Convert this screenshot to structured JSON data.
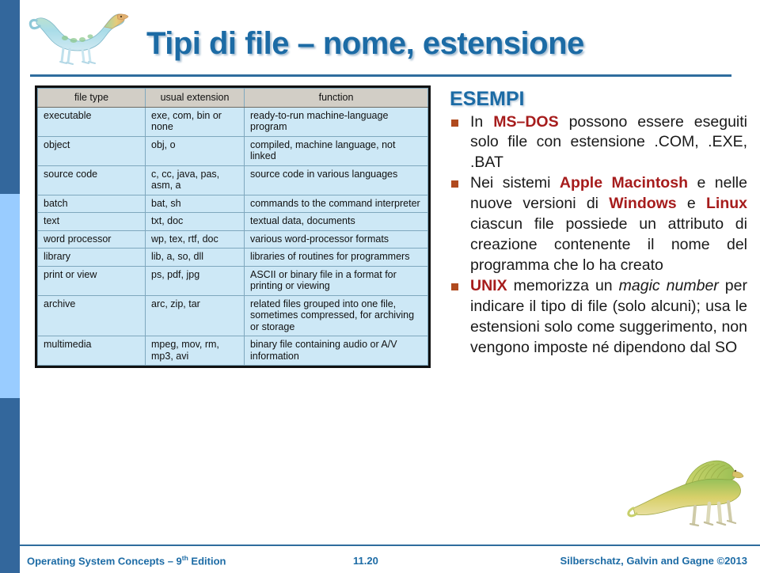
{
  "colors": {
    "title_blue": "#1C6BA5",
    "sidebar_dark": "#33679C",
    "sidebar_light": "#99CCFF",
    "table_header_bg": "#D2CEC6",
    "table_row_bg": "#CDE8F6",
    "highlight_red": "#A61C1C",
    "bullet_orange": "#B04A1E"
  },
  "header": {
    "title": "Tipi di file – nome, estensione",
    "logo_icon": "dinosaur-icon"
  },
  "table": {
    "columns": [
      "file type",
      "usual extension",
      "function"
    ],
    "rows": [
      {
        "type": "executable",
        "ext": "exe, com, bin or none",
        "fn": "ready-to-run machine-language program"
      },
      {
        "type": "object",
        "ext": "obj, o",
        "fn": "compiled, machine language, not linked"
      },
      {
        "type": "source code",
        "ext": "c, cc, java, pas, asm, a",
        "fn": "source code in various languages"
      },
      {
        "type": "batch",
        "ext": "bat, sh",
        "fn": "commands to the command interpreter"
      },
      {
        "type": "text",
        "ext": "txt, doc",
        "fn": "textual data, documents"
      },
      {
        "type": "word processor",
        "ext": "wp, tex, rtf, doc",
        "fn": "various word-processor formats"
      },
      {
        "type": "library",
        "ext": "lib, a, so, dll",
        "fn": "libraries of routines for programmers"
      },
      {
        "type": "print or view",
        "ext": "ps, pdf, jpg",
        "fn": "ASCII or binary file in a format for printing or viewing"
      },
      {
        "type": "archive",
        "ext": "arc, zip, tar",
        "fn": "related files grouped into one file, sometimes compressed, for archiving or storage"
      },
      {
        "type": "multimedia",
        "ext": "mpeg, mov, rm, mp3, avi",
        "fn": "binary file containing audio or A/V information"
      }
    ]
  },
  "examples": {
    "heading": "ESEMPI",
    "bullets": [
      {
        "parts": [
          {
            "text": "In ",
            "style": "normal"
          },
          {
            "text": "MS–DOS",
            "style": "highlight"
          },
          {
            "text": " possono essere eseguiti solo file con estensione .COM, .EXE, .BAT",
            "style": "normal"
          }
        ]
      },
      {
        "parts": [
          {
            "text": "Nei sistemi ",
            "style": "normal"
          },
          {
            "text": "Apple Macintosh",
            "style": "highlight"
          },
          {
            "text": " e nelle nuove versioni di ",
            "style": "normal"
          },
          {
            "text": "Windows",
            "style": "highlight"
          },
          {
            "text": " e ",
            "style": "normal"
          },
          {
            "text": "Linux",
            "style": "highlight"
          },
          {
            "text": " ciascun file possiede un attributo di creazione contenente il nome del programma che lo ha creato",
            "style": "normal"
          }
        ]
      },
      {
        "parts": [
          {
            "text": "UNIX",
            "style": "highlight"
          },
          {
            "text": " memorizza un ",
            "style": "normal"
          },
          {
            "text": "magic number",
            "style": "italic"
          },
          {
            "text": " per indicare il tipo di file (solo alcuni); usa le estensioni solo come suggerimento, non vengono imposte né dipendono dal SO",
            "style": "normal"
          }
        ]
      }
    ]
  },
  "footer": {
    "left_main": "Operating System Concepts – 9",
    "left_sup": "th",
    "left_tail": " Edition",
    "slide_number": "11.20",
    "credit": "Silberschatz, Galvin and Gagne ©2013",
    "dino_icon": "dinosaur-icon"
  }
}
